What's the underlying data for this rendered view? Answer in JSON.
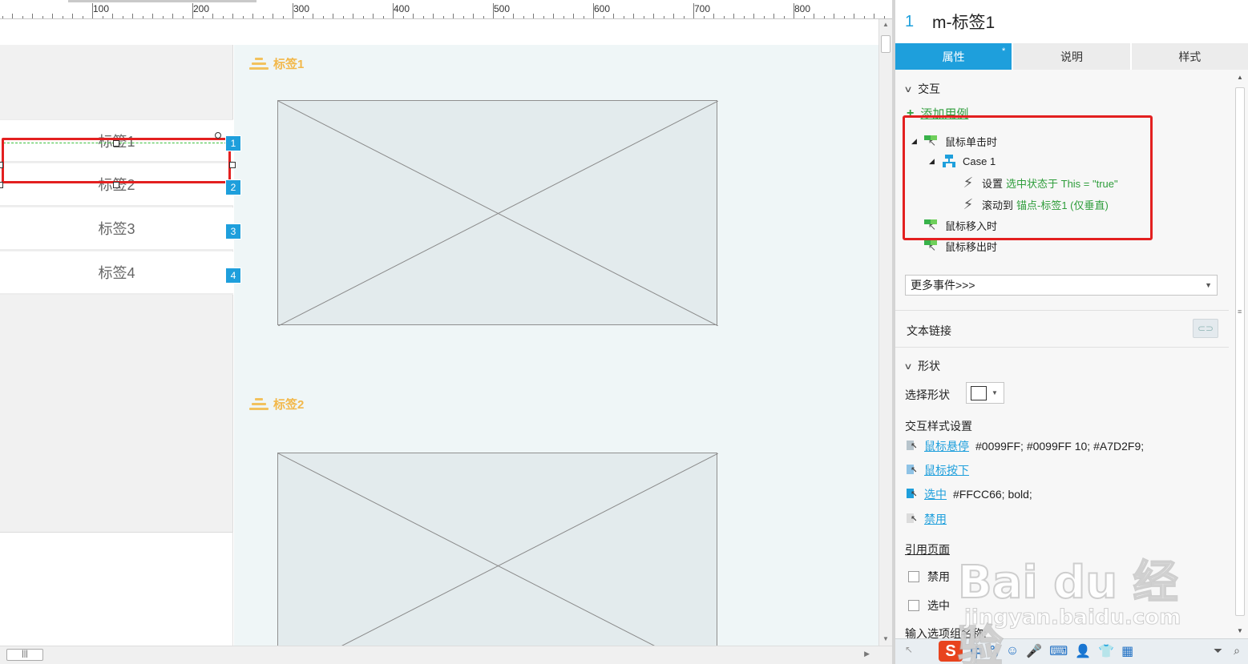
{
  "ruler": {
    "ticks": [
      "100",
      "200",
      "300",
      "400",
      "500",
      "600",
      "700",
      "800"
    ]
  },
  "canvas": {
    "tabs": [
      "标签1",
      "标签2",
      "标签3",
      "标签4"
    ],
    "badges": [
      "1",
      "2",
      "3",
      "4"
    ],
    "anchors": [
      "标签1",
      "标签2"
    ]
  },
  "inspector": {
    "widget_number": "1",
    "widget_name": "m-标签1",
    "tabs": {
      "properties": "属性",
      "properties_marker": "*",
      "notes": "说明",
      "style": "样式"
    },
    "interaction": {
      "heading": "交互",
      "add_case": "添加用例",
      "events": {
        "on_click": "鼠标单击时",
        "case_name": "Case 1",
        "action1_verb": "设置",
        "action1_detail": "选中状态于 This = \"true\"",
        "action2_verb": "滚动到",
        "action2_detail": "锚点-标签1 (仅垂直)",
        "on_mouse_enter": "鼠标移入时",
        "on_mouse_leave": "鼠标移出时"
      },
      "more_events": "更多事件>>>"
    },
    "text_link": "文本链接",
    "shape": {
      "heading": "形状",
      "select_shape": "选择形状"
    },
    "interaction_styles": {
      "heading": "交互样式设置",
      "hover_label": "鼠标悬停",
      "hover_value": "#0099FF; #0099FF 10; #A7D2F9;",
      "mousedown_label": "鼠标按下",
      "selected_label": "选中",
      "selected_value": "#FFCC66; bold;",
      "disabled_label": "禁用"
    },
    "reference_page": "引用页面",
    "checkbox_disabled": "禁用",
    "checkbox_selected": "选中",
    "group_name_label": "输入选项组名称:"
  },
  "ime": {
    "logo": "S",
    "mode": "中",
    "punct": "°,"
  },
  "watermark": {
    "brand": "Bai du 经验",
    "url": "jingyan.baidu.com"
  },
  "colors": {
    "accent": "#1e9fdc",
    "highlight_red": "#e32020",
    "anchor_yellow": "#f2b84b",
    "link_green": "#2e9d3b"
  }
}
